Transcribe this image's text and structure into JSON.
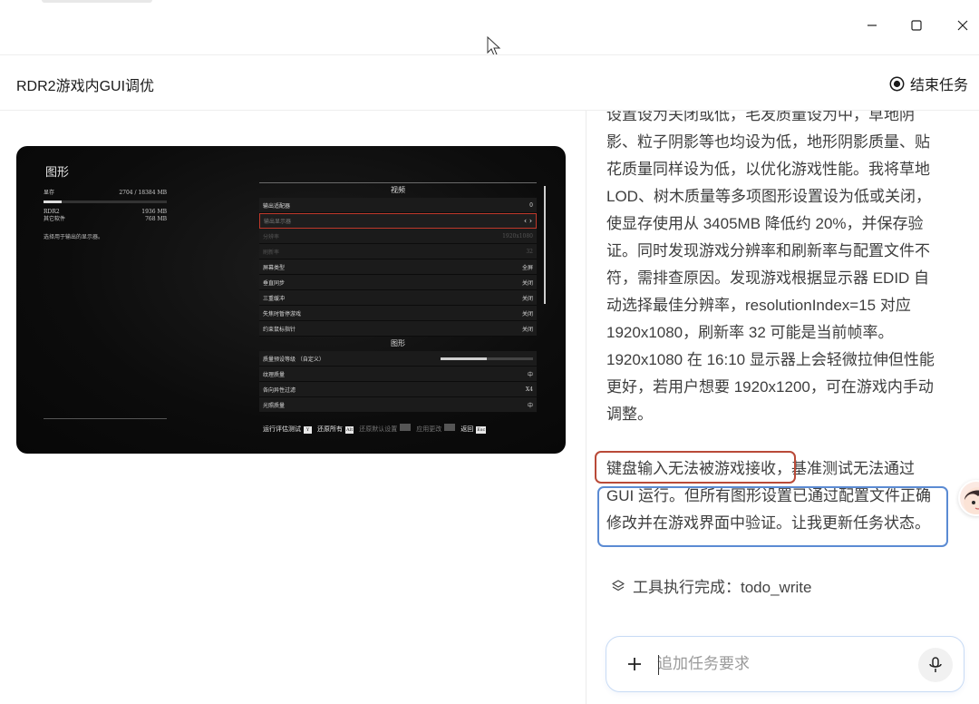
{
  "window": {
    "controls": {
      "minimize": "minimize-icon",
      "maximize": "maximize-icon",
      "close": "close-icon"
    }
  },
  "header": {
    "title": "RDR2游戏内GUI调优",
    "end_task_label": "结束任务"
  },
  "game_screenshot": {
    "title": "图形",
    "vram": {
      "label": "显存",
      "value": "2704 / 18384 MB",
      "fraction": 0.147
    },
    "usage": [
      {
        "name": "RDR2",
        "value": "1936 MB"
      },
      {
        "name": "其它软件",
        "value": "768 MB"
      }
    ],
    "note": "选择用于输出的显示器。",
    "section_video": "视频",
    "video_items": [
      {
        "label": "输出适配器",
        "value": "0",
        "state": "normal"
      },
      {
        "label": "输出显示器",
        "value": "",
        "state": "selected"
      },
      {
        "label": "分辨率",
        "value": "1920x1080",
        "state": "dim"
      },
      {
        "label": "刷新率",
        "value": "32",
        "state": "dim"
      },
      {
        "label": "屏幕类型",
        "value": "全屏",
        "state": "normal"
      },
      {
        "label": "垂直同步",
        "value": "关闭",
        "state": "normal"
      },
      {
        "label": "三重缓冲",
        "value": "关闭",
        "state": "normal"
      },
      {
        "label": "失焦时暂停游戏",
        "value": "关闭",
        "state": "normal"
      },
      {
        "label": "约束鼠标指针",
        "value": "关闭",
        "state": "normal"
      }
    ],
    "section_graphics": "图形",
    "quality_preset": {
      "label": "质量预设等级 （自定义）",
      "fraction": 0.5
    },
    "graphics_items": [
      {
        "label": "纹理质量",
        "value": "中"
      },
      {
        "label": "各向异性过滤",
        "value": "X4"
      },
      {
        "label": "光照质量",
        "value": "中"
      }
    ],
    "bottom_bar": {
      "run_benchmark": "运行评估测试",
      "run_benchmark_key": "Y",
      "restore_all": "还原所有",
      "restore_all_key": "Alt",
      "restore_defaults": "还原默认设置",
      "apply_changes": "应用更改",
      "back": "返回",
      "back_key": "Esc"
    }
  },
  "assistant": {
    "message_lines": [
      "设置设为关闭或低，毛发质量设为中，草地阴",
      "影、粒子阴影等也均设为低，地形阴影质量、贴",
      "花质量同样设为低，以优化游戏性能。我将草地",
      "LOD、树木质量等多项图形设置设为低或关闭，",
      "使显存使用从 3405MB 降低约 20%，并保存验",
      "证。同时发现游戏分辨率和刷新率与配置文件不",
      "符，需排查原因。发现游戏根据显示器 EDID 自",
      "动选择最佳分辨率，resolutionIndex=15 对应",
      "1920x1080，刷新率 32 可能是当前帧率。",
      "1920x1080 在 16:10 显示器上会轻微拉伸但性能",
      "更好，若用户想要 1920x1200，可在游戏内手动",
      "调整。"
    ],
    "message2_lines": [
      "键盘输入无法被游戏接收，基准测试无法通过",
      "GUI 运行。但所有图形设置已通过配置文件正确",
      "修改并在游戏界面中验证。让我更新任务状态。"
    ],
    "tool_status": "工具执行完成：todo_write"
  },
  "composer": {
    "placeholder": "追加任务要求",
    "value": ""
  },
  "colors": {
    "highlight_red": "#b94a38",
    "highlight_blue": "#5b8bd3",
    "input_border": "#c8dbf5"
  }
}
